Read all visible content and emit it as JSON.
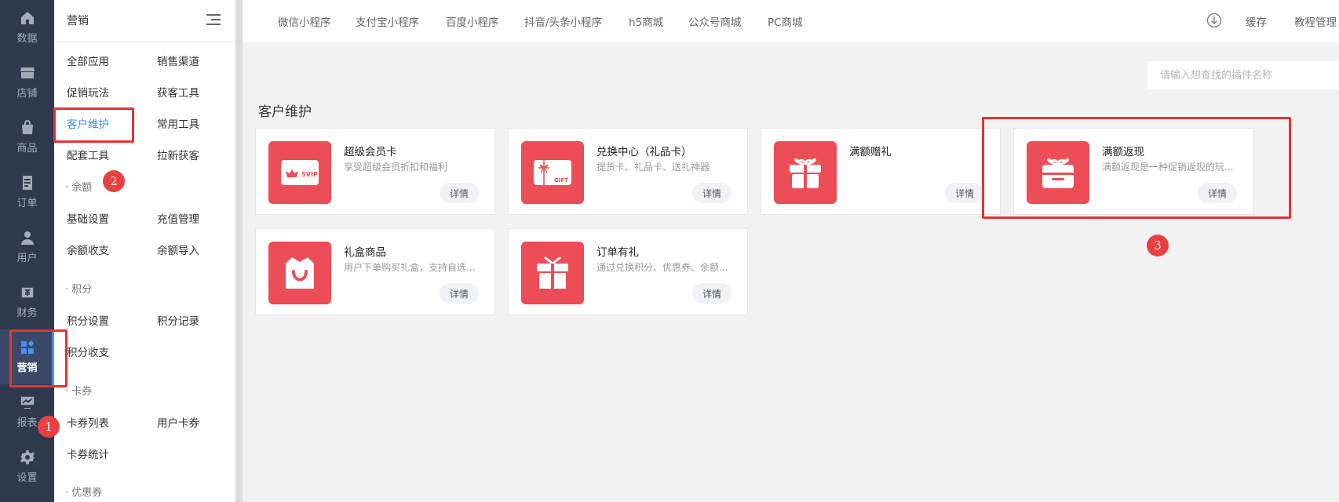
{
  "rail": [
    {
      "label": "数据",
      "icon": "home-icon"
    },
    {
      "label": "店铺",
      "icon": "store-icon"
    },
    {
      "label": "商品",
      "icon": "bag-icon"
    },
    {
      "label": "订单",
      "icon": "order-icon"
    },
    {
      "label": "用户",
      "icon": "user-icon"
    },
    {
      "label": "财务",
      "icon": "finance-icon"
    },
    {
      "label": "营销",
      "icon": "marketing-icon",
      "active": true
    },
    {
      "label": "报表",
      "icon": "report-icon"
    },
    {
      "label": "设置",
      "icon": "gear-icon"
    }
  ],
  "submenu": {
    "title": "营销",
    "items": [
      "全部应用",
      "销售渠道",
      "促销玩法",
      "获客工具",
      "客户维护",
      "常用工具",
      "配套工具",
      "拉新获客"
    ],
    "sections": [
      {
        "title": "· 余额",
        "items": [
          "基础设置",
          "充值管理",
          "余额收支",
          "余额导入"
        ]
      },
      {
        "title": "· 积分",
        "items": [
          "积分设置",
          "积分记录",
          "积分收支"
        ]
      },
      {
        "title": "· 卡券",
        "items": [
          "卡券列表",
          "用户卡券",
          "卡券统计"
        ]
      },
      {
        "title": "· 优惠券",
        "items": []
      }
    ]
  },
  "topbar": {
    "tabs": [
      "微信小程序",
      "支付宝小程序",
      "百度小程序",
      "抖音/头条小程序",
      "h5商城",
      "公众号商城",
      "PC商城"
    ],
    "cache": "缓存",
    "tutorial": "教程管理"
  },
  "search": {
    "placeholder": "请输入想查找的插件名称"
  },
  "section_title": "客户维护",
  "cards": [
    {
      "title": "超级会员卡",
      "desc": "享受超级会员折扣和福利",
      "btn": "详情",
      "icon": "svip-card-icon"
    },
    {
      "title": "兑换中心（礼品卡）",
      "desc": "提货卡、礼品卡、送礼神器",
      "btn": "详情",
      "icon": "gift-card-icon"
    },
    {
      "title": "满额赠礼",
      "desc": "",
      "btn": "详情",
      "icon": "gift-box-icon"
    },
    {
      "title": "满额返现",
      "desc": "满额返现是一种促销返现的玩...",
      "btn": "详情",
      "icon": "gift-box-icon"
    },
    {
      "title": "礼盒商品",
      "desc": "用户下单购买礼盒，支持自选...",
      "btn": "详情",
      "icon": "shopping-bag-icon"
    },
    {
      "title": "订单有礼",
      "desc": "通过兑换积分、优惠券、余额...",
      "btn": "详情",
      "icon": "gift-box-icon"
    }
  ],
  "annotations": [
    "1",
    "2",
    "3"
  ],
  "colors": {
    "accent": "#ec4d57",
    "rail": "#2f3a4f",
    "highlight": "#e53333",
    "selected": "#3a8ee6"
  }
}
